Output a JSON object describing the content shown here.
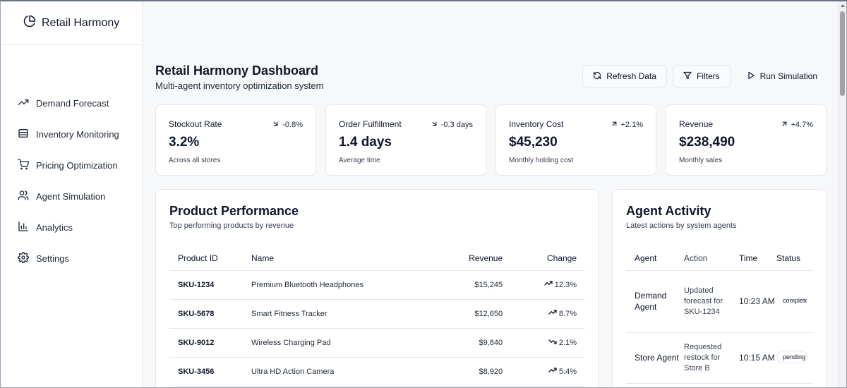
{
  "app": {
    "name": "Retail Harmony"
  },
  "sidebar": {
    "items": [
      {
        "label": "Demand Forecast",
        "icon": "trending-up-icon"
      },
      {
        "label": "Inventory Monitoring",
        "icon": "database-icon"
      },
      {
        "label": "Pricing Optimization",
        "icon": "cart-icon"
      },
      {
        "label": "Agent Simulation",
        "icon": "users-icon"
      },
      {
        "label": "Analytics",
        "icon": "bar-chart-icon"
      },
      {
        "label": "Settings",
        "icon": "gear-icon"
      }
    ]
  },
  "header": {
    "title": "Retail Harmony Dashboard",
    "subtitle": "Multi-agent inventory optimization system",
    "refresh_label": "Refresh Data",
    "filters_label": "Filters",
    "simulate_label": "Run Simulation"
  },
  "kpis": [
    {
      "title": "Stockout Rate",
      "change": "-0.8%",
      "direction": "down",
      "value": "3.2%",
      "note": "Across all stores"
    },
    {
      "title": "Order Fulfillment",
      "change": "-0.3 days",
      "direction": "down",
      "value": "1.4 days",
      "note": "Average time"
    },
    {
      "title": "Inventory Cost",
      "change": "+2.1%",
      "direction": "up",
      "value": "$45,230",
      "note": "Monthly holding cost"
    },
    {
      "title": "Revenue",
      "change": "+4.7%",
      "direction": "up",
      "value": "$238,490",
      "note": "Monthly sales"
    }
  ],
  "performance": {
    "title": "Product Performance",
    "subtitle": "Top performing products by revenue",
    "columns": {
      "id": "Product ID",
      "name": "Name",
      "revenue": "Revenue",
      "change": "Change"
    },
    "rows": [
      {
        "id": "SKU-1234",
        "name": "Premium Bluetooth Headphones",
        "revenue": "$15,245",
        "change": "12.3%",
        "direction": "up"
      },
      {
        "id": "SKU-5678",
        "name": "Smart Fitness Tracker",
        "revenue": "$12,650",
        "change": "8.7%",
        "direction": "up"
      },
      {
        "id": "SKU-9012",
        "name": "Wireless Charging Pad",
        "revenue": "$9,840",
        "change": "2.1%",
        "direction": "down"
      },
      {
        "id": "SKU-3456",
        "name": "Ultra HD Action Camera",
        "revenue": "$8,920",
        "change": "5.4%",
        "direction": "up"
      }
    ]
  },
  "activity": {
    "title": "Agent Activity",
    "subtitle": "Latest actions by system agents",
    "columns": {
      "agent": "Agent",
      "action": "Action",
      "time": "Time",
      "status": "Status"
    },
    "rows": [
      {
        "agent": "Demand Agent",
        "action": "Updated forecast for SKU-1234",
        "time": "10:23 AM",
        "status": "completed"
      },
      {
        "agent": "Store Agent",
        "action": "Requested restock for Store B",
        "time": "10:15 AM",
        "status": "pending"
      }
    ]
  }
}
